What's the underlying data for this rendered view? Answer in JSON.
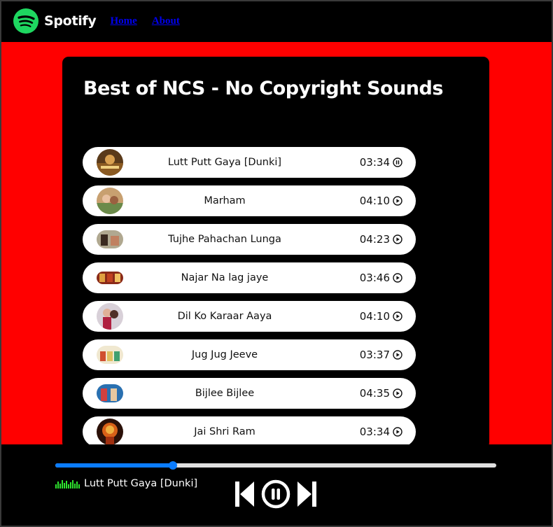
{
  "nav": {
    "brand": "Spotify",
    "brand_icon": "spotify-logo-icon",
    "brand_color": "#1ed760",
    "links": [
      "Home",
      "About"
    ]
  },
  "playlist": {
    "title": "Best of NCS - No Copyright Sounds",
    "songs": [
      {
        "name": "Lutt Putt Gaya [Dunki]",
        "duration": "03:34",
        "state_icon": "pause-circle-icon"
      },
      {
        "name": "Marham",
        "duration": "04:10",
        "state_icon": "play-circle-icon"
      },
      {
        "name": "Tujhe Pahachan Lunga",
        "duration": "04:23",
        "state_icon": "play-circle-icon"
      },
      {
        "name": "Najar Na lag jaye",
        "duration": "03:46",
        "state_icon": "play-circle-icon"
      },
      {
        "name": "Dil Ko Karaar Aaya",
        "duration": "04:10",
        "state_icon": "play-circle-icon"
      },
      {
        "name": "Jug Jug Jeeve",
        "duration": "03:37",
        "state_icon": "play-circle-icon"
      },
      {
        "name": "Bijlee Bijlee",
        "duration": "04:35",
        "state_icon": "play-circle-icon"
      },
      {
        "name": "Jai Shri Ram",
        "duration": "03:34",
        "state_icon": "play-circle-icon"
      }
    ]
  },
  "player": {
    "now_playing": "Lutt Putt Gaya [Dunki]",
    "progress_fraction": 0.266,
    "accent": "#0a7cff",
    "controls": [
      "previous-icon",
      "pause-circle-icon",
      "next-icon"
    ]
  },
  "colors": {
    "page_background": "#ff0000",
    "panel": "#000000"
  }
}
